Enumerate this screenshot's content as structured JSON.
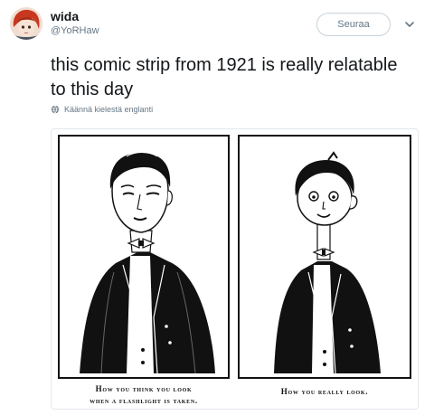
{
  "user": {
    "name": "wida",
    "handle": "@YoRHaw"
  },
  "follow_label": "Seuraa",
  "tweet": {
    "text": "this comic strip from 1921 is really relatable to this day"
  },
  "translate_label": "Käännä kielestä englanti",
  "comic": {
    "caption_left_1": "How you think you look",
    "caption_left_2": "when a flashlight is taken.",
    "caption_right": "How you really look."
  }
}
